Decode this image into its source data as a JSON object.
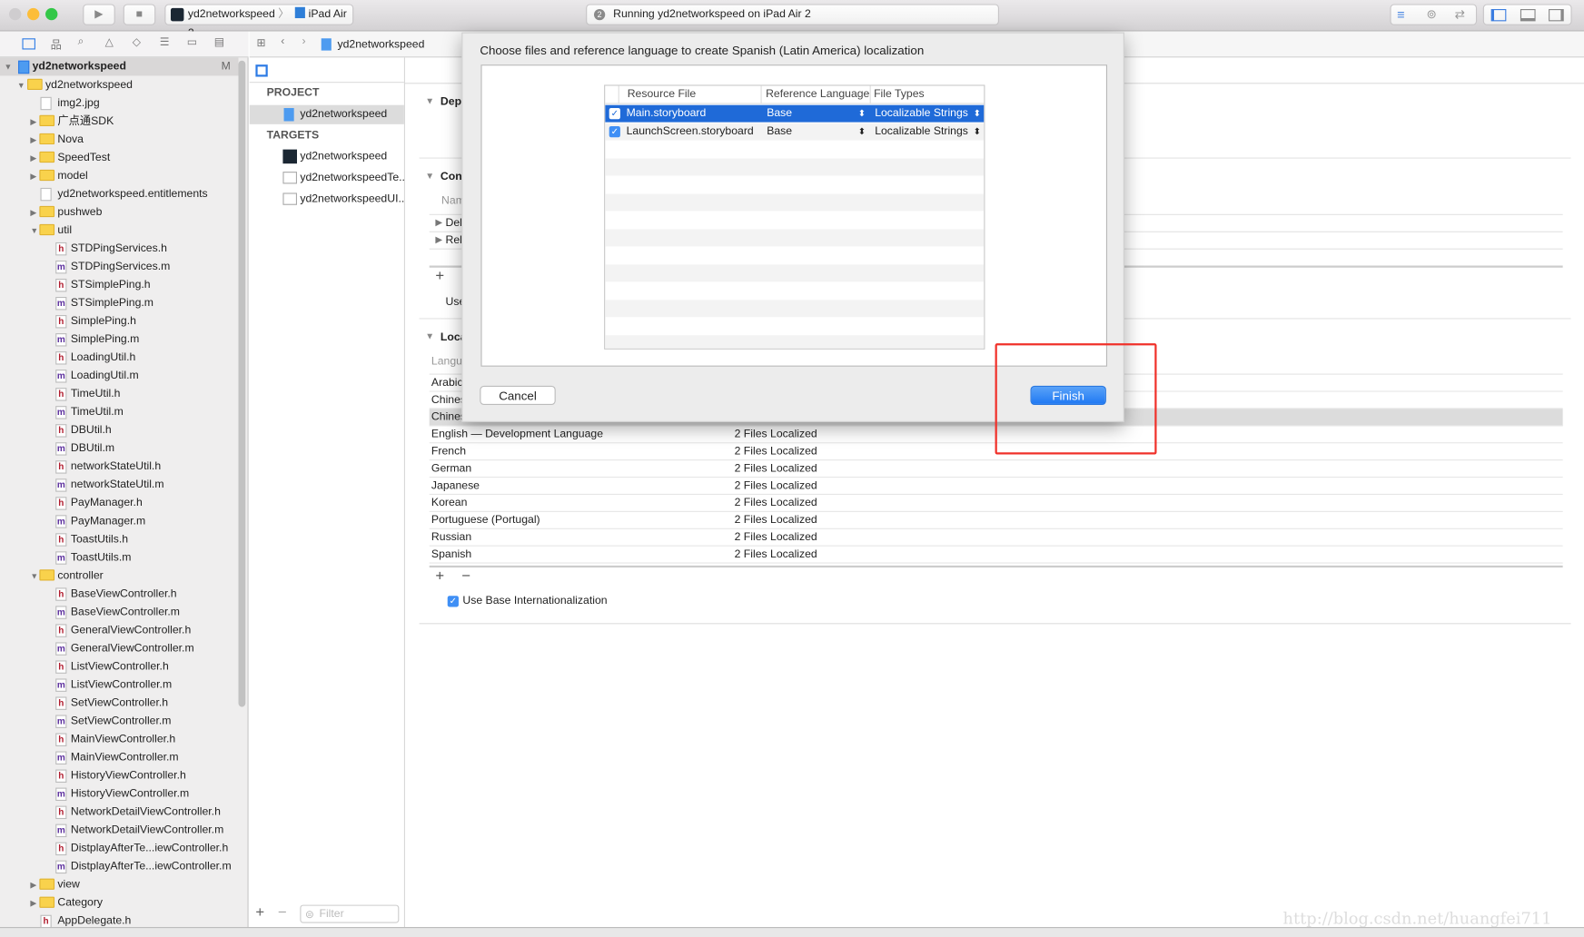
{
  "toolbar": {
    "scheme": "yd2networkspeed",
    "device": "iPad Air 2",
    "activity": "Running yd2networkspeed on iPad Air 2",
    "activity_badge": "2"
  },
  "jumpbar": {
    "file": "yd2networkspeed"
  },
  "sidebar": {
    "badge": "M",
    "items": [
      {
        "label": "yd2networkspeed",
        "level": 0,
        "type": "project",
        "arrow": "open"
      },
      {
        "label": "yd2networkspeed",
        "level": 1,
        "type": "folder",
        "arrow": "open"
      },
      {
        "label": "img2.jpg",
        "level": 2,
        "type": "img"
      },
      {
        "label": "广点通SDK",
        "level": 2,
        "type": "folder",
        "arrow": "closed"
      },
      {
        "label": "Nova",
        "level": 2,
        "type": "folder",
        "arrow": "closed"
      },
      {
        "label": "SpeedTest",
        "level": 2,
        "type": "folder",
        "arrow": "closed"
      },
      {
        "label": "model",
        "level": 2,
        "type": "folder",
        "arrow": "closed"
      },
      {
        "label": "yd2networkspeed.entitlements",
        "level": 2,
        "type": "ent"
      },
      {
        "label": "pushweb",
        "level": 2,
        "type": "folder",
        "arrow": "closed"
      },
      {
        "label": "util",
        "level": 2,
        "type": "folder",
        "arrow": "open"
      },
      {
        "label": "STDPingServices.h",
        "level": 3,
        "type": "h"
      },
      {
        "label": "STDPingServices.m",
        "level": 3,
        "type": "m"
      },
      {
        "label": "STSimplePing.h",
        "level": 3,
        "type": "h"
      },
      {
        "label": "STSimplePing.m",
        "level": 3,
        "type": "m"
      },
      {
        "label": "SimplePing.h",
        "level": 3,
        "type": "h"
      },
      {
        "label": "SimplePing.m",
        "level": 3,
        "type": "m"
      },
      {
        "label": "LoadingUtil.h",
        "level": 3,
        "type": "h"
      },
      {
        "label": "LoadingUtil.m",
        "level": 3,
        "type": "m"
      },
      {
        "label": "TimeUtil.h",
        "level": 3,
        "type": "h"
      },
      {
        "label": "TimeUtil.m",
        "level": 3,
        "type": "m"
      },
      {
        "label": "DBUtil.h",
        "level": 3,
        "type": "h"
      },
      {
        "label": "DBUtil.m",
        "level": 3,
        "type": "m"
      },
      {
        "label": "networkStateUtil.h",
        "level": 3,
        "type": "h"
      },
      {
        "label": "networkStateUtil.m",
        "level": 3,
        "type": "m"
      },
      {
        "label": "PayManager.h",
        "level": 3,
        "type": "h"
      },
      {
        "label": "PayManager.m",
        "level": 3,
        "type": "m"
      },
      {
        "label": "ToastUtils.h",
        "level": 3,
        "type": "h"
      },
      {
        "label": "ToastUtils.m",
        "level": 3,
        "type": "m"
      },
      {
        "label": "controller",
        "level": 2,
        "type": "folder",
        "arrow": "open"
      },
      {
        "label": "BaseViewController.h",
        "level": 3,
        "type": "h"
      },
      {
        "label": "BaseViewController.m",
        "level": 3,
        "type": "m"
      },
      {
        "label": "GeneralViewController.h",
        "level": 3,
        "type": "h"
      },
      {
        "label": "GeneralViewController.m",
        "level": 3,
        "type": "m"
      },
      {
        "label": "ListViewController.h",
        "level": 3,
        "type": "h"
      },
      {
        "label": "ListViewController.m",
        "level": 3,
        "type": "m"
      },
      {
        "label": "SetViewController.h",
        "level": 3,
        "type": "h"
      },
      {
        "label": "SetViewController.m",
        "level": 3,
        "type": "m"
      },
      {
        "label": "MainViewController.h",
        "level": 3,
        "type": "h"
      },
      {
        "label": "MainViewController.m",
        "level": 3,
        "type": "m"
      },
      {
        "label": "HistoryViewController.h",
        "level": 3,
        "type": "h"
      },
      {
        "label": "HistoryViewController.m",
        "level": 3,
        "type": "m"
      },
      {
        "label": "NetworkDetailViewController.h",
        "level": 3,
        "type": "h"
      },
      {
        "label": "NetworkDetailViewController.m",
        "level": 3,
        "type": "m"
      },
      {
        "label": "DistplayAfterTe...iewController.h",
        "level": 3,
        "type": "h"
      },
      {
        "label": "DistplayAfterTe...iewController.m",
        "level": 3,
        "type": "m"
      },
      {
        "label": "view",
        "level": 2,
        "type": "folder",
        "arrow": "closed"
      },
      {
        "label": "Category",
        "level": 2,
        "type": "folder",
        "arrow": "closed"
      },
      {
        "label": "AppDelegate.h",
        "level": 2,
        "type": "h"
      }
    ]
  },
  "targets_panel": {
    "project_header": "PROJECT",
    "project": "yd2networkspeed",
    "targets_header": "TARGETS",
    "targets": [
      "yd2networkspeed",
      "yd2networkspeedTe...",
      "yd2networkspeedUI..."
    ],
    "filter_placeholder": "Filter"
  },
  "editor": {
    "sec1": "Dep",
    "sec2": "Con",
    "name_col": "Nam",
    "conf1": "Del",
    "conf2": "Rel",
    "use": "Use",
    "sec3": "Loca",
    "lang_col": "Langua",
    "languages": [
      {
        "name": "Arabic",
        "status": ""
      },
      {
        "name": "Chines",
        "status": ""
      },
      {
        "name": "Chines",
        "status": ""
      },
      {
        "name": "English — Development Language",
        "status": "2 Files Localized"
      },
      {
        "name": "French",
        "status": "2 Files Localized"
      },
      {
        "name": "German",
        "status": "2 Files Localized"
      },
      {
        "name": "Japanese",
        "status": "2 Files Localized"
      },
      {
        "name": "Korean",
        "status": "2 Files Localized"
      },
      {
        "name": "Portuguese (Portugal)",
        "status": "2 Files Localized"
      },
      {
        "name": "Russian",
        "status": "2 Files Localized"
      },
      {
        "name": "Spanish",
        "status": "2 Files Localized"
      }
    ],
    "base_intl": "Use Base Internationalization",
    "base_intl_checked": true
  },
  "dialog": {
    "title": "Choose files and reference language to create Spanish (Latin America) localization",
    "columns": [
      "Resource File",
      "Reference Language",
      "File Types"
    ],
    "rows": [
      {
        "checked": true,
        "file": "Main.storyboard",
        "lang": "Base",
        "type": "Localizable Strings",
        "selected": true
      },
      {
        "checked": true,
        "file": "LaunchScreen.storyboard",
        "lang": "Base",
        "type": "Localizable Strings",
        "selected": false
      }
    ],
    "cancel": "Cancel",
    "finish": "Finish"
  },
  "watermark": "http://blog.csdn.net/huangfei711",
  "colors": {
    "accent": "#1f6ad8",
    "highlight_box": "#f0312a",
    "finish": "#2d86f5"
  }
}
